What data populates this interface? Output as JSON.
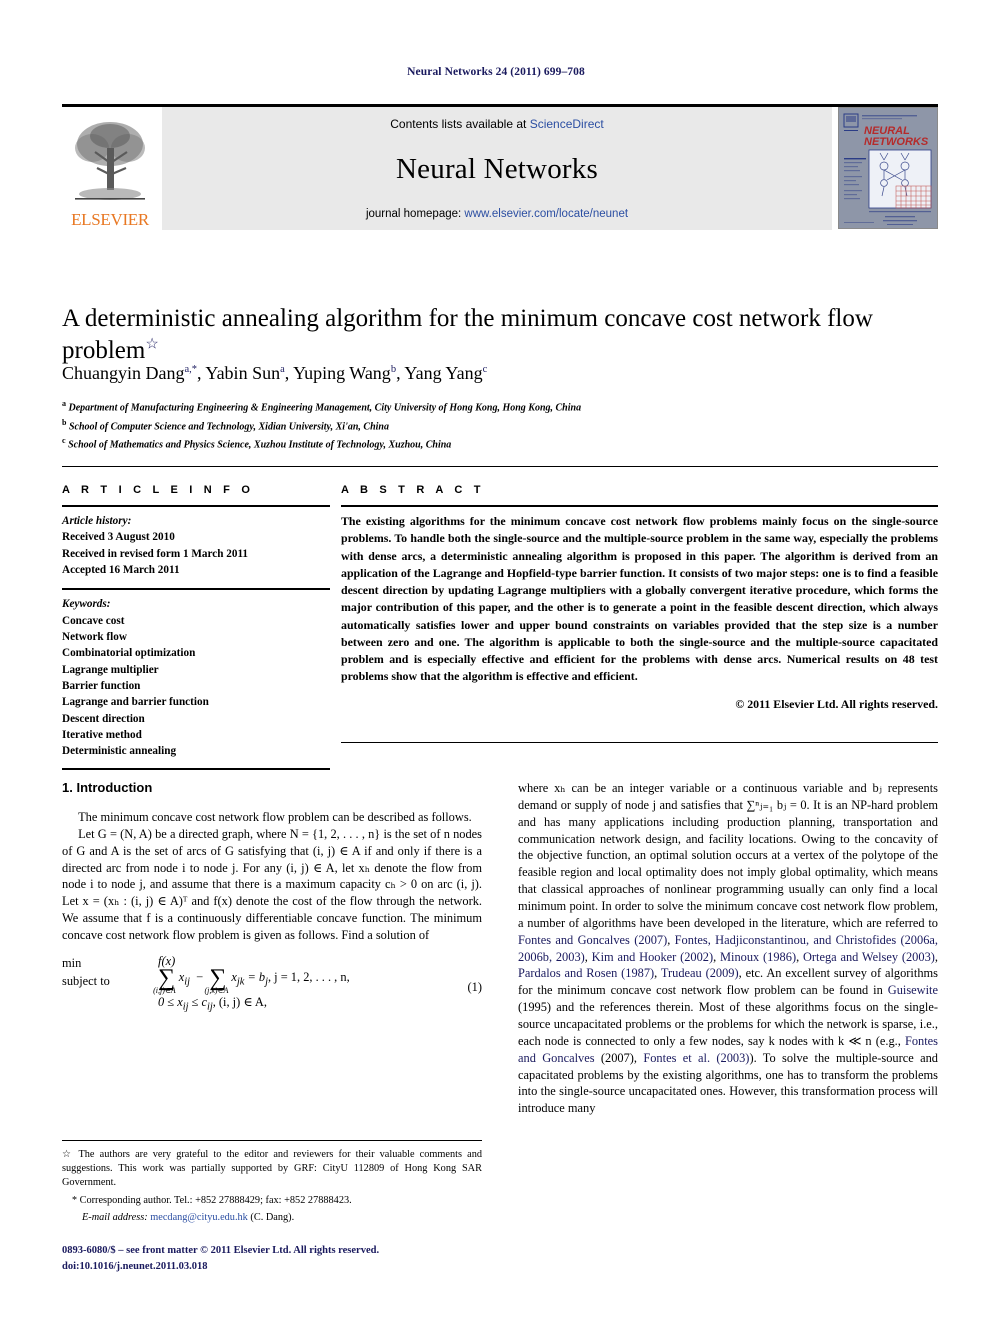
{
  "running_head": "Neural Networks 24 (2011) 699–708",
  "masthead": {
    "contents_prefix": "Contents lists available at",
    "contents_link": "ScienceDirect",
    "journal_title": "Neural Networks",
    "homepage_prefix": "journal homepage:",
    "homepage_link": "www.elsevier.com/locate/neunet",
    "publisher_name": "ELSEVIER",
    "cover": {
      "title_line1": "NEURAL",
      "title_line2": "NETWORKS",
      "top_strip": "OFFICIAL JOURNAL OF THE INTERNATIONAL NEURAL NETWORK SOCIETY",
      "footer": "Available online at ScienceDirect"
    }
  },
  "article": {
    "title": "A deterministic annealing algorithm for the minimum concave cost network flow problem",
    "title_footnote_marker": "☆",
    "authors": [
      {
        "name": "Chuangyin Dang",
        "sup": "a,*"
      },
      {
        "name": "Yabin Sun",
        "sup": "a"
      },
      {
        "name": "Yuping Wang",
        "sup": "b"
      },
      {
        "name": "Yang Yang",
        "sup": "c"
      }
    ],
    "affiliations": [
      {
        "label": "a",
        "text": "Department of Manufacturing Engineering & Engineering Management, City University of Hong Kong, Hong Kong, China"
      },
      {
        "label": "b",
        "text": "School of Computer Science and Technology, Xidian University, Xi'an, China"
      },
      {
        "label": "c",
        "text": "School of Mathematics and Physics Science, Xuzhou Institute of Technology, Xuzhou, China"
      }
    ]
  },
  "article_info": {
    "heading": "A R T I C L E   I N F O",
    "history_label": "Article history:",
    "history": [
      "Received 3 August 2010",
      "Received in revised form 1 March 2011",
      "Accepted 16 March 2011"
    ],
    "keywords_label": "Keywords:",
    "keywords": [
      "Concave cost",
      "Network flow",
      "Combinatorial optimization",
      "Lagrange multiplier",
      "Barrier function",
      "Lagrange and barrier function",
      "Descent direction",
      "Iterative method",
      "Deterministic annealing"
    ]
  },
  "abstract": {
    "heading": "A B S T R A C T",
    "text": "The existing algorithms for the minimum concave cost network flow problems mainly focus on the single-source problems. To handle both the single-source and the multiple-source problem in the same way, especially the problems with dense arcs, a deterministic annealing algorithm is proposed in this paper. The algorithm is derived from an application of the Lagrange and Hopfield-type barrier function. It consists of two major steps: one is to find a feasible descent direction by updating Lagrange multipliers with a globally convergent iterative procedure, which forms the major contribution of this paper, and the other is to generate a point in the feasible descent direction, which always automatically satisfies lower and upper bound constraints on variables provided that the step size is a number between zero and one. The algorithm is applicable to both the single-source and the multiple-source capacitated problem and is especially effective and efficient for the problems with dense arcs. Numerical results on 48 test problems show that the algorithm is effective and efficient.",
    "copyright": "© 2011 Elsevier Ltd. All rights reserved."
  },
  "body": {
    "section_heading": "1.  Introduction",
    "left_paragraphs": [
      "The minimum concave cost network flow problem can be described as follows.",
      "Let G = (N, A) be a directed graph, where N = {1, 2, . . . , n} is the set of n nodes of G and A is the set of arcs of G satisfying that (i, j) ∈ A if and only if there is a directed arc from node i to node j. For any (i, j) ∈ A, let xₕ denote the flow from node i to node j, and assume that there is a maximum capacity cₕ > 0 on arc (i, j). Let x = (xₕ : (i, j) ∈ A)ᵀ and f(x) denote the cost of the flow through the network. We assume that f is a continuously differentiable concave function. The minimum concave cost network flow problem is given as follows. Find a solution of"
    ],
    "equation": {
      "label_min": "min",
      "label_subject": "subject to",
      "objective": "f(x)",
      "constraint_sum_left": "x",
      "constraint_sum_left_sub": "ij",
      "constraint_sum_left_limit": "(i,j)∈A",
      "constraint_sum_right": "x",
      "constraint_sum_right_sub": "jk",
      "constraint_sum_right_limit": "(j,k)∈A",
      "constraint_rhs": "= b",
      "constraint_rhs_sub": "j",
      "constraint_range": ", j = 1, 2, . . . , n,",
      "bounds": "0 ≤ x",
      "bounds_sub1": "ij",
      "bounds_mid": " ≤ c",
      "bounds_sub2": "ij",
      "bounds_tail": ",   (i, j) ∈ A,",
      "number": "(1)"
    },
    "right_paragraphs": [
      "where xₕ can be an integer variable or a continuous variable and bⱼ represents demand or supply of node j and satisfies that ∑ⁿⱼ₌₁ bⱼ = 0. It is an NP-hard problem and has many applications including production planning, transportation and communication network design, and facility locations. Owing to the concavity of the objective function, an optimal solution occurs at a vertex of the polytope of the feasible region and local optimality does not imply global optimality, which means that classical approaches of nonlinear programming usually can only find a local minimum point. In order to solve the minimum concave cost network flow problem, a number of algorithms have been developed in the literature, which are referred to "
    ],
    "citations": [
      "Fontes and Goncalves (2007)",
      "Fontes, Hadjiconstantinou, and Christofides (2006a, 2006b, 2003)",
      "Kim and Hooker (2002)",
      "Minoux (1986)",
      "Ortega and Welsey (2003)",
      "Pardalos and Rosen (1987)",
      "Trudeau (2009)",
      "Guisewite",
      "Fontes and Goncalves",
      "Fontes et al. (2003)"
    ],
    "right_tail_1": ", etc. An excellent survey of algorithms for the minimum concave cost network flow problem can be found in ",
    "right_tail_2": " (1995) and the references therein. Most of these algorithms focus on the single-source uncapacitated problems or the problems for which the network is sparse, i.e., each node is connected to only a few nodes, say k nodes with k ≪ n (e.g., ",
    "right_tail_3": " (2007), ",
    "right_tail_4": "). To solve the multiple-source and capacitated problems by the existing algorithms, one has to transform the problems into the single-source uncapacitated ones. However, this transformation process will introduce many"
  },
  "footnotes": {
    "star_marker": "☆",
    "star_text": "The authors are very grateful to the editor and reviewers for their valuable comments and suggestions. This work was partially supported by GRF: CityU 112809 of Hong Kong SAR Government.",
    "corresponding_marker": "*",
    "corresponding_text": "Corresponding author. Tel.: +852 27888429; fax: +852 27888423.",
    "email_label": "E-mail address:",
    "email": "mecdang@cityu.edu.hk",
    "email_suffix": "(C. Dang)."
  },
  "footer": {
    "issn_line": "0893-6080/$ – see front matter © 2011 Elsevier Ltd. All rights reserved.",
    "doi_line": "doi:10.1016/j.neunet.2011.03.018"
  },
  "colors": {
    "link_blue": "#2b4ea2",
    "dark_navy": "#1a1a5e",
    "elsevier_orange": "#E87722",
    "banner_gray": "#e9e9e9"
  }
}
